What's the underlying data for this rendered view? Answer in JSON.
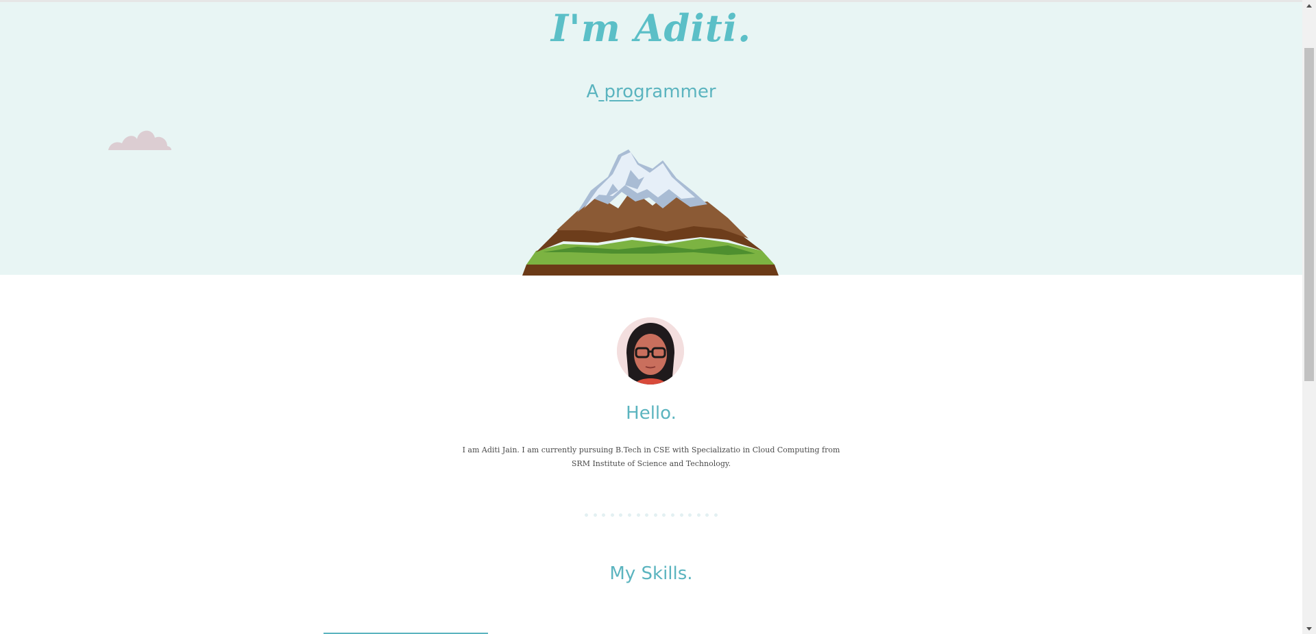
{
  "hero": {
    "title": "I'm Aditi.",
    "subtitle_prefix": "A",
    "subtitle_typed": " pro",
    "subtitle_rest": "grammer"
  },
  "icons": {
    "cloud": "cloud-icon",
    "mountain": "mountain-illustration",
    "avatar": "profile-photo"
  },
  "about": {
    "heading": "Hello.",
    "bio": "I am Aditi Jain. I am currently pursuing B.Tech in CSE with Specializatio in Cloud Computing from SRM Institute of Science and Technology."
  },
  "skills": {
    "heading": "My Skills."
  },
  "colors": {
    "accent": "#5bb4bf",
    "hero_bg": "#e8f5f4",
    "cloud": "#dcccd1"
  }
}
